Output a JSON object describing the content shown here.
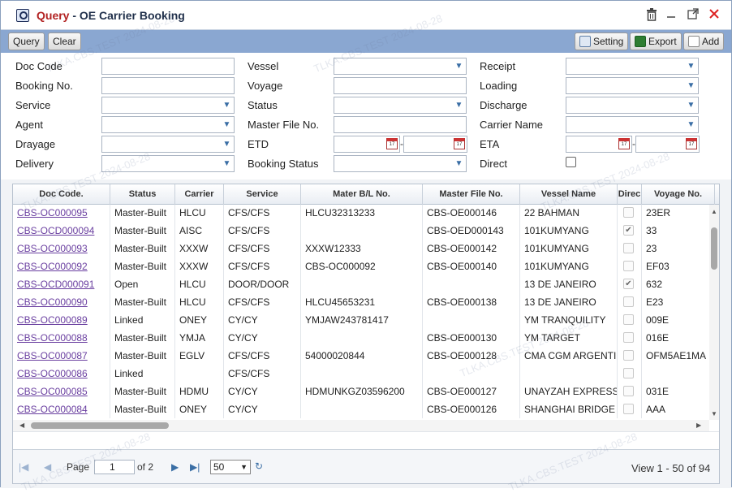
{
  "window": {
    "title_prefix": "Query",
    "title_suffix": "- OE Carrier Booking"
  },
  "toolbar": {
    "query_label": "Query",
    "clear_label": "Clear",
    "setting_label": "Setting",
    "export_label": "Export",
    "add_label": "Add"
  },
  "form": {
    "doc_code": "Doc Code",
    "booking_no": "Booking No.",
    "service": "Service",
    "agent": "Agent",
    "drayage": "Drayage",
    "delivery": "Delivery",
    "vessel": "Vessel",
    "voyage": "Voyage",
    "status": "Status",
    "master_file_no": "Master File No.",
    "etd": "ETD",
    "booking_status": "Booking Status",
    "receipt": "Receipt",
    "loading": "Loading",
    "discharge": "Discharge",
    "carrier_name": "Carrier Name",
    "eta": "ETA",
    "direct": "Direct",
    "date_sep": "-",
    "cal_icon_text": "17"
  },
  "grid": {
    "columns": [
      "Doc Code.",
      "Status",
      "Carrier",
      "Service",
      "Mater B/L No.",
      "Master File No.",
      "Vessel Name",
      "Direc",
      "Voyage No."
    ],
    "rows": [
      {
        "doc": "CBS-OC000095",
        "status": "Master-Built",
        "carrier": "HLCU",
        "service": "CFS/CFS",
        "mbl": "HLCU32313233",
        "mfile": "CBS-OE000146",
        "vessel": "22 BAHMAN",
        "direct": "",
        "voyage": "23ER"
      },
      {
        "doc": "CBS-OCD000094",
        "status": "Master-Built",
        "carrier": "AISC",
        "service": "CFS/CFS",
        "mbl": "",
        "mfile": "CBS-OED000143",
        "vessel": "101KUMYANG",
        "direct": "✔",
        "voyage": "33"
      },
      {
        "doc": "CBS-OC000093",
        "status": "Master-Built",
        "carrier": "XXXW",
        "service": "CFS/CFS",
        "mbl": "XXXW12333",
        "mfile": "CBS-OE000142",
        "vessel": "101KUMYANG",
        "direct": "",
        "voyage": "23"
      },
      {
        "doc": "CBS-OC000092",
        "status": "Master-Built",
        "carrier": "XXXW",
        "service": "CFS/CFS",
        "mbl": "CBS-OC000092",
        "mfile": "CBS-OE000140",
        "vessel": "101KUMYANG",
        "direct": "",
        "voyage": "EF03"
      },
      {
        "doc": "CBS-OCD000091",
        "status": "Open",
        "carrier": "HLCU",
        "service": "DOOR/DOOR",
        "mbl": "",
        "mfile": "",
        "vessel": "13 DE JANEIRO",
        "direct": "✔",
        "voyage": "632"
      },
      {
        "doc": "CBS-OC000090",
        "status": "Master-Built",
        "carrier": "HLCU",
        "service": "CFS/CFS",
        "mbl": "HLCU45653231",
        "mfile": "CBS-OE000138",
        "vessel": "13 DE JANEIRO",
        "direct": "",
        "voyage": "E23"
      },
      {
        "doc": "CBS-OC000089",
        "status": "Linked",
        "carrier": "ONEY",
        "service": "CY/CY",
        "mbl": "YMJAW243781417",
        "mfile": "",
        "vessel": "YM TRANQUILITY",
        "direct": "",
        "voyage": "009E"
      },
      {
        "doc": "CBS-OC000088",
        "status": "Master-Built",
        "carrier": "YMJA",
        "service": "CY/CY",
        "mbl": "",
        "mfile": "CBS-OE000130",
        "vessel": "YM TARGET",
        "direct": "",
        "voyage": "016E"
      },
      {
        "doc": "CBS-OC000087",
        "status": "Master-Built",
        "carrier": "EGLV",
        "service": "CFS/CFS",
        "mbl": "54000020844",
        "mfile": "CBS-OE000128",
        "vessel": "CMA CGM ARGENTI",
        "direct": "",
        "voyage": "OFM5AE1MA"
      },
      {
        "doc": "CBS-OC000086",
        "status": "Linked",
        "carrier": "",
        "service": "CFS/CFS",
        "mbl": "",
        "mfile": "",
        "vessel": "",
        "direct": "",
        "voyage": ""
      },
      {
        "doc": "CBS-OC000085",
        "status": "Master-Built",
        "carrier": "HDMU",
        "service": "CY/CY",
        "mbl": "HDMUNKGZ03596200",
        "mfile": "CBS-OE000127",
        "vessel": "UNAYZAH EXPRESS",
        "direct": "",
        "voyage": "031E"
      },
      {
        "doc": "CBS-OC000084",
        "status": "Master-Built",
        "carrier": "ONEY",
        "service": "CY/CY",
        "mbl": "",
        "mfile": "CBS-OE000126",
        "vessel": "SHANGHAI BRIDGE",
        "direct": "",
        "voyage": "AAA"
      }
    ]
  },
  "pager": {
    "page_label": "Page",
    "page_value": "1",
    "of_label": "of 2",
    "page_size": "50",
    "summary": "View 1 - 50 of 94"
  },
  "watermark": "TLKA.CBS.TEST 2024-08-28",
  "colors": {
    "toolbar_bg": "#8aa7d1",
    "title_red": "#b22222",
    "link_purple": "#6a3fa0",
    "accent_blue": "#3a6ea5"
  }
}
